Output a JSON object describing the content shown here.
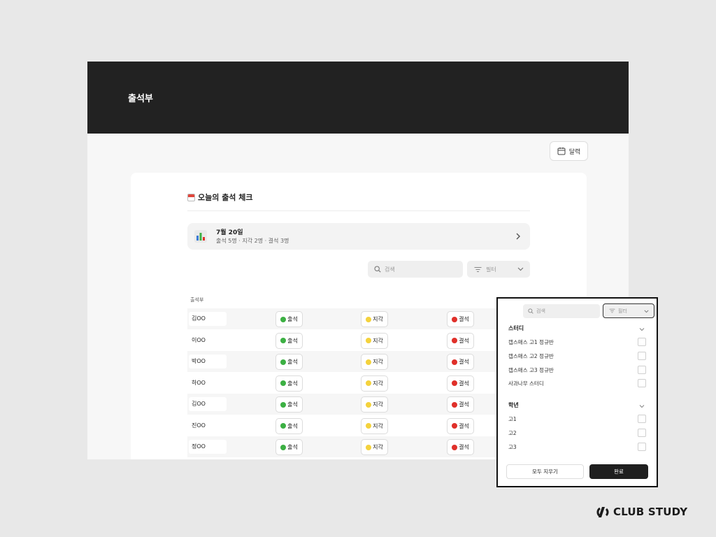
{
  "header": {
    "title": "출석부"
  },
  "calendar_button": {
    "label": "달력",
    "icon": "calendar-icon"
  },
  "section": {
    "title": "오늘의 출석 체크",
    "icon": "calendar-emoji-icon"
  },
  "summary": {
    "date": "7월 20일",
    "counts": "출석 5명 · 지각 2명 · 결석 3명",
    "icon": "bar-chart-icon"
  },
  "search": {
    "placeholder": "검색"
  },
  "filter": {
    "label": "필터"
  },
  "list": {
    "label": "출석부",
    "status_labels": {
      "present": "출석",
      "late": "지각",
      "absent": "결석"
    },
    "rows": [
      {
        "name": "김OO"
      },
      {
        "name": "이OO"
      },
      {
        "name": "박OO"
      },
      {
        "name": "하OO"
      },
      {
        "name": "김OO"
      },
      {
        "name": "진OO"
      },
      {
        "name": "정OO"
      }
    ]
  },
  "filter_popover": {
    "search_placeholder": "검색",
    "filter_label": "필터",
    "groups": [
      {
        "title": "스터디",
        "options": [
          "캡스매스 고1 정규반",
          "캡스매스 고2 정규반",
          "캡스매스 고3 정규반",
          "사과나무 스터디"
        ]
      },
      {
        "title": "학년",
        "options": [
          "고1",
          "고2",
          "고3"
        ]
      }
    ],
    "clear_label": "모두 지우기",
    "done_label": "완료"
  },
  "brand": {
    "name": "CLUB STUDY"
  },
  "colors": {
    "present": "#3cb043",
    "late": "#f4d23c",
    "absent": "#e0302a",
    "header_bg": "#222222",
    "accent_dark": "#1f1f1f"
  }
}
